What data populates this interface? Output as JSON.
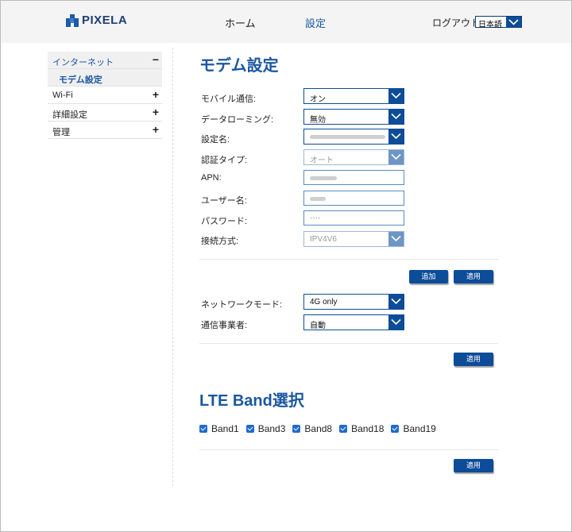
{
  "header": {
    "logo_text": "PIXELA",
    "nav_home": "ホーム",
    "nav_settings": "設定",
    "logout": "ログアウト",
    "language": "日本語"
  },
  "sidebar": {
    "groups": [
      {
        "label": "インターネット",
        "sign": "−",
        "expanded": true,
        "children": [
          "モデム設定"
        ]
      },
      {
        "label": "Wi-Fi",
        "sign": "+"
      },
      {
        "label": "詳細設定",
        "sign": "+"
      },
      {
        "label": "管理",
        "sign": "+"
      }
    ]
  },
  "modem": {
    "title": "モデム設定",
    "fields": {
      "mobile_data": {
        "label": "モバイル通信:",
        "value": "オン"
      },
      "roaming": {
        "label": "データローミング:",
        "value": "無効"
      },
      "profile_name": {
        "label": "設定名:",
        "value": ""
      },
      "auth_type": {
        "label": "認証タイプ:",
        "value": "オート"
      },
      "apn": {
        "label": "APN:",
        "value": ""
      },
      "username": {
        "label": "ユーザー名:",
        "value": ""
      },
      "password": {
        "label": "パスワード:",
        "value": "····"
      },
      "connection": {
        "label": "接続方式:",
        "value": "IPV4V6"
      }
    },
    "add_button": "追加",
    "apply_button": "適用"
  },
  "network": {
    "mode": {
      "label": "ネットワークモード:",
      "value": "4G only"
    },
    "carrier": {
      "label": "通信事業者:",
      "value": "自動"
    },
    "apply_button": "適用"
  },
  "lte": {
    "title": "LTE Band選択",
    "bands": [
      {
        "label": "Band1",
        "checked": true
      },
      {
        "label": "Band3",
        "checked": true
      },
      {
        "label": "Band8",
        "checked": true
      },
      {
        "label": "Band18",
        "checked": true
      },
      {
        "label": "Band19",
        "checked": true
      }
    ],
    "apply_button": "適用"
  },
  "colors": {
    "accent": "#0d4c98",
    "title": "#1b57a0"
  }
}
